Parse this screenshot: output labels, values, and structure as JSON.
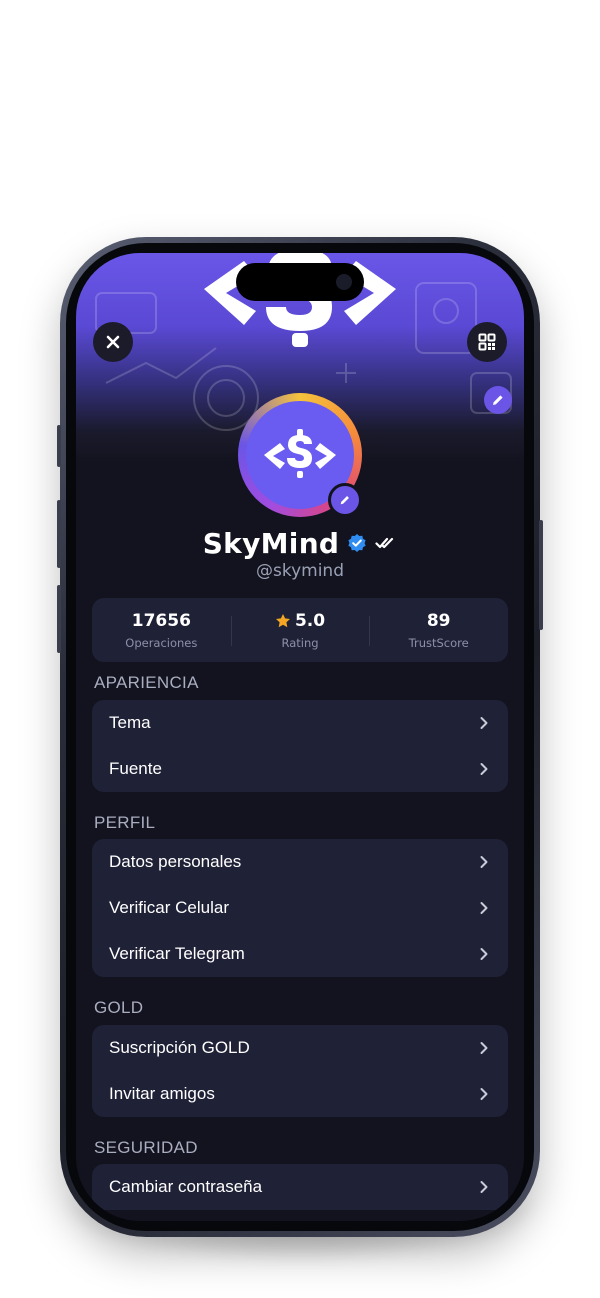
{
  "profile": {
    "name": "SkyMind",
    "handle": "@skymind"
  },
  "stats": [
    {
      "value": "17656",
      "label": "Operaciones"
    },
    {
      "value": "5.0",
      "label": "Rating",
      "icon": "star-icon"
    },
    {
      "value": "89",
      "label": "TrustScore"
    }
  ],
  "sections": {
    "apariencia": {
      "title": "APARIENCIA",
      "items": [
        "Tema",
        "Fuente"
      ]
    },
    "perfil": {
      "title": "PERFIL",
      "items": [
        "Datos personales",
        "Verificar Celular",
        "Verificar Telegram"
      ]
    },
    "gold": {
      "title": "GOLD",
      "items": [
        "Suscripción GOLD",
        "Invitar amigos"
      ]
    },
    "seguridad": {
      "title": "SEGURIDAD",
      "items": [
        "Cambiar contraseña"
      ]
    }
  },
  "icons": {
    "close": "close-icon",
    "qr": "qr-code-icon",
    "edit": "pencil-icon",
    "verified": "verified-badge-icon",
    "seen": "double-check-icon",
    "chevron": "chevron-right-icon"
  },
  "colors": {
    "accent": "#6b55e6",
    "background": "#13131f",
    "card": "#1f2137",
    "star": "#f5a623",
    "verified": "#2f8cf0"
  }
}
